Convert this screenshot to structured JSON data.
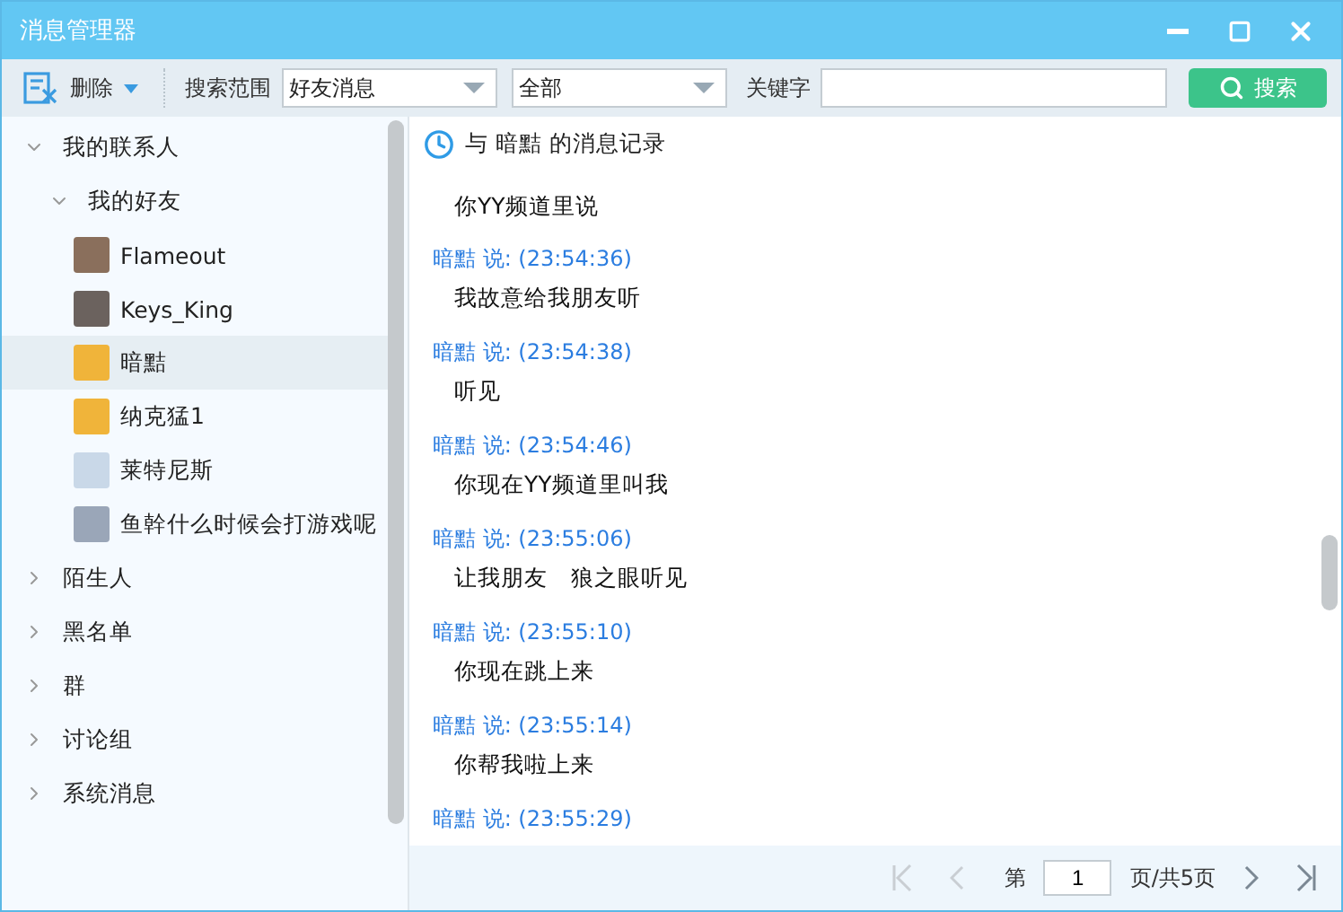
{
  "window": {
    "title": "消息管理器"
  },
  "toolbar": {
    "delete_label": "删除",
    "scope_label": "搜索范围",
    "scope_value": "好友消息",
    "range_value": "全部",
    "keyword_label": "关键字",
    "search_button": "搜索"
  },
  "tree": [
    {
      "label": "我的联系人",
      "kind": "group",
      "expanded": true,
      "selected": false,
      "children": [
        {
          "label": "我的好友",
          "kind": "group",
          "expanded": true,
          "selected": false,
          "children": [
            {
              "label": "Flameout",
              "kind": "contact",
              "selected": false,
              "color": "#8a6f5c"
            },
            {
              "label": "Keys_King",
              "kind": "contact",
              "selected": false,
              "color": "#6b625e"
            },
            {
              "label": "暗黠",
              "kind": "contact",
              "selected": true,
              "color": "#f0b43a"
            },
            {
              "label": "纳克猛1",
              "kind": "contact",
              "selected": false,
              "color": "#f0b43a"
            },
            {
              "label": "莱特尼斯",
              "kind": "contact",
              "selected": false,
              "color": "#c9d8e8"
            },
            {
              "label": "鱼幹什么时候会打游戏呢",
              "kind": "contact",
              "selected": false,
              "color": "#9aa6b8"
            }
          ]
        }
      ]
    },
    {
      "label": "陌生人",
      "kind": "group",
      "expanded": false,
      "selected": false
    },
    {
      "label": "黑名单",
      "kind": "group",
      "expanded": false,
      "selected": false
    },
    {
      "label": "群",
      "kind": "group",
      "expanded": false,
      "selected": false
    },
    {
      "label": "讨论组",
      "kind": "group",
      "expanded": false,
      "selected": false
    },
    {
      "label": "系统消息",
      "kind": "group",
      "expanded": false,
      "selected": false
    }
  ],
  "chat": {
    "prefix": "与",
    "contact": "暗黠",
    "suffix": "的消息记录",
    "messages": [
      {
        "text": "你YY频道里说"
      },
      {
        "header": "暗黠 说: (23:54:36)",
        "text": "我故意给我朋友听"
      },
      {
        "header": "暗黠 说: (23:54:38)",
        "text": "听见"
      },
      {
        "header": "暗黠 说: (23:54:46)",
        "text": "你现在YY频道里叫我"
      },
      {
        "header": "暗黠 说: (23:55:06)",
        "text": "让我朋友　狼之眼听见"
      },
      {
        "header": "暗黠 说: (23:55:10)",
        "text": "你现在跳上来"
      },
      {
        "header": "暗黠 说: (23:55:14)",
        "text": "你帮我啦上来"
      },
      {
        "header": "暗黠 说: (23:55:29)"
      }
    ]
  },
  "pager": {
    "first_disabled": true,
    "prev_disabled": true,
    "next_disabled": false,
    "last_disabled": false,
    "page_prefix": "第",
    "page": "1",
    "page_suffix": "页/共5页"
  }
}
